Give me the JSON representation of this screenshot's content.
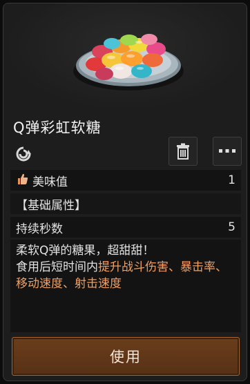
{
  "item": {
    "name": "Q弹彩虹软糖",
    "image_icon": "rainbow-gummy-candy-plate",
    "rarity_icon": "rarity-swirl-icon"
  },
  "actions": {
    "delete_icon": "trash-icon",
    "more_icon": "more-dots-icon"
  },
  "stats": {
    "taste_label": "美味值",
    "taste_value": "1",
    "section_label": "【基础属性】",
    "duration_label": "持续秒数",
    "duration_value": "5"
  },
  "description": {
    "line1": "柔软Q弹的糖果，超甜甜！",
    "line2_prefix": "食用后短时间内",
    "line2_highlight": "提升战斗伤害、暴击率、移动速度、射击速度"
  },
  "colors": {
    "highlight": "#f0a060",
    "button_fill": "#5f3618",
    "button_border": "#a8652e"
  },
  "buttons": {
    "use_label": "使用"
  }
}
